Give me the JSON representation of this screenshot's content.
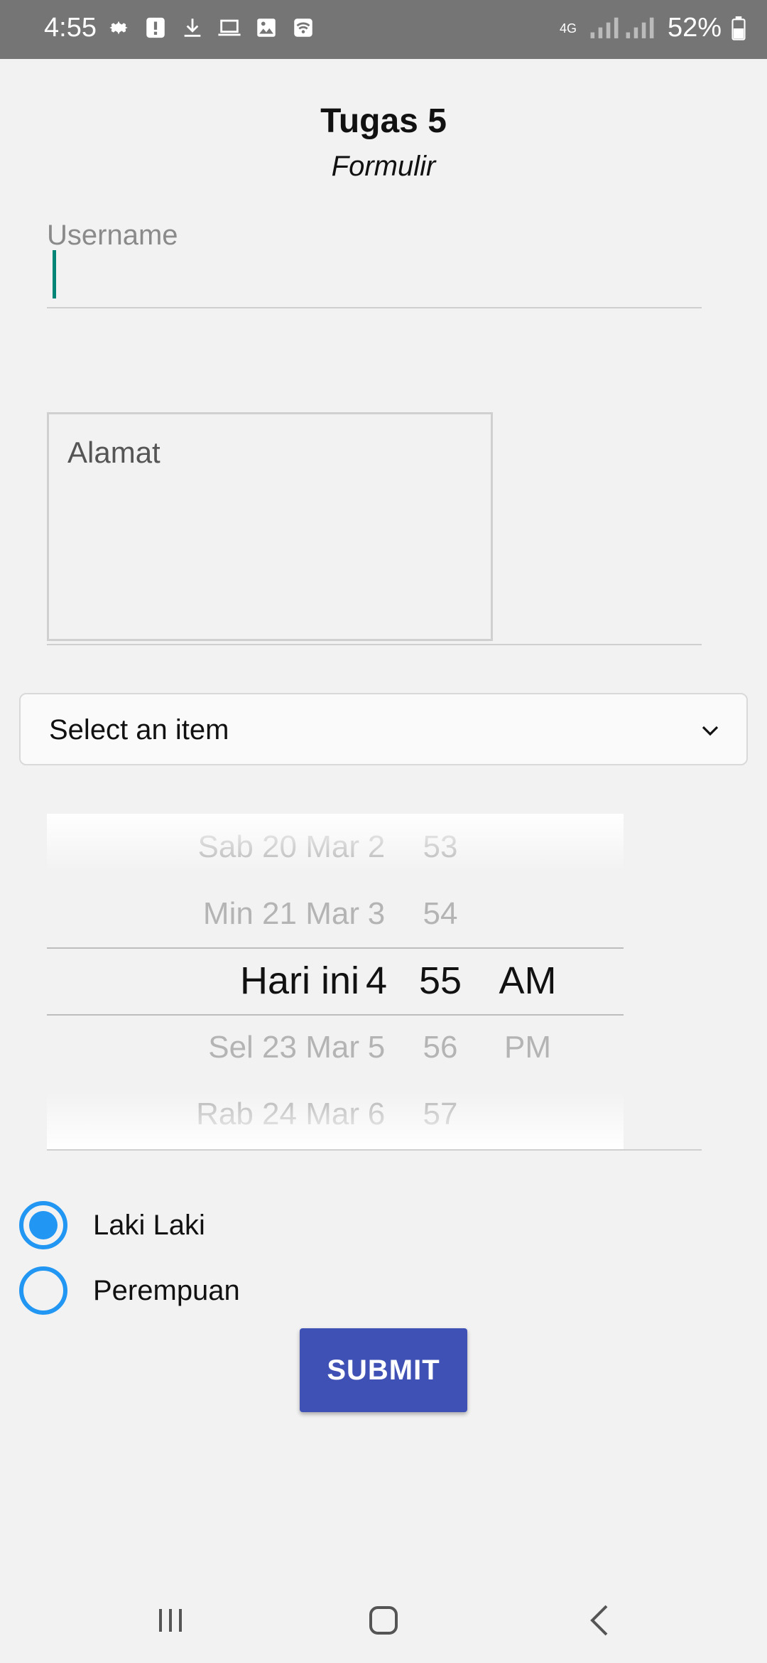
{
  "status_bar": {
    "time": "4:55",
    "icons": [
      "settings-icon",
      "alert-icon",
      "download-icon",
      "laptop-icon",
      "image-icon",
      "wifi-hotspot-icon"
    ],
    "network": "4G",
    "battery": "52%"
  },
  "header": {
    "title": "Tugas 5",
    "subtitle": "Formulir"
  },
  "form": {
    "username": {
      "label": "Username",
      "value": ""
    },
    "alamat": {
      "placeholder": "Alamat",
      "value": ""
    },
    "spinner": {
      "selected": "Select an item"
    },
    "picker": {
      "rows": [
        {
          "date": "Sab 20 Mar",
          "hour": "2",
          "minute": "53",
          "ampm": ""
        },
        {
          "date": "Min 21 Mar",
          "hour": "3",
          "minute": "54",
          "ampm": ""
        },
        {
          "date": "Hari ini",
          "hour": "4",
          "minute": "55",
          "ampm": "AM"
        },
        {
          "date": "Sel 23 Mar",
          "hour": "5",
          "minute": "56",
          "ampm": "PM"
        },
        {
          "date": "Rab 24 Mar",
          "hour": "6",
          "minute": "57",
          "ampm": ""
        }
      ],
      "selected_index": 2
    },
    "gender": {
      "options": [
        {
          "label": "Laki Laki",
          "checked": true
        },
        {
          "label": "Perempuan",
          "checked": false
        }
      ]
    },
    "submit_label": "SUBMIT"
  },
  "nav_bar": {
    "buttons": [
      "recents-icon",
      "home-icon",
      "back-icon"
    ]
  },
  "colors": {
    "accent": "#2196f3",
    "button": "#3f51b5",
    "cursor": "#008577",
    "status_bar": "#757575"
  }
}
